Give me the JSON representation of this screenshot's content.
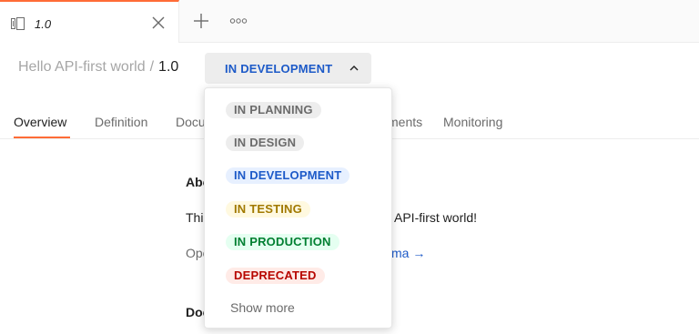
{
  "tabbar": {
    "tab": {
      "label": "1.0",
      "icon": "api-icon"
    },
    "new_tab_icon": "plus-icon",
    "more_icon": "more-horizontal-icon"
  },
  "header": {
    "breadcrumb_parent": "Hello API-first world",
    "separator": "/",
    "version": "1.0",
    "status_button": {
      "label": "IN DEVELOPMENT",
      "color": "#1d5ac8",
      "icon": "chevron-up-icon"
    }
  },
  "subtabs": {
    "items": [
      {
        "label": "Overview",
        "active": true
      },
      {
        "label": "Definition",
        "active": false
      },
      {
        "label": "Docu",
        "active": false
      },
      {
        "label": "ments",
        "active": false
      },
      {
        "label": "Monitoring",
        "active": false
      }
    ],
    "accent": "#ff6c37"
  },
  "content": {
    "about_heading": "Abo",
    "intro_start": "Thi",
    "intro_end": "API-first world!",
    "open_start": "Ope",
    "schema_link": "ma →",
    "docs_heading": "Doc"
  },
  "status_menu": {
    "items": [
      {
        "label": "IN PLANNING",
        "text_color": "#6b6b6b",
        "bg_color": "#ededed"
      },
      {
        "label": "IN DESIGN",
        "text_color": "#6b6b6b",
        "bg_color": "#ededed"
      },
      {
        "label": "IN DEVELOPMENT",
        "text_color": "#1d5ac8",
        "bg_color": "#e7f0ff"
      },
      {
        "label": "IN TESTING",
        "text_color": "#a17900",
        "bg_color": "#fff9e0"
      },
      {
        "label": "IN PRODUCTION",
        "text_color": "#007f31",
        "bg_color": "#e5fff1"
      },
      {
        "label": "DEPRECATED",
        "text_color": "#b70700",
        "bg_color": "#ffebe7"
      }
    ],
    "show_more": "Show more"
  }
}
